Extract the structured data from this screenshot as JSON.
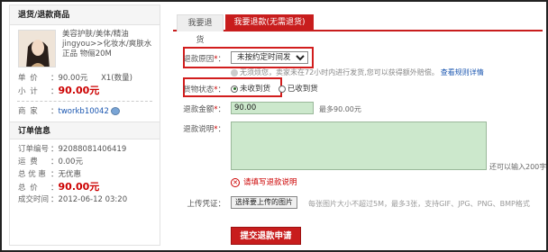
{
  "sidebar": {
    "title": "退货/退款商品",
    "product_name": "美容护肤/美体/精油 jingyou>>化妆水/爽肤水 正品 物俪20M",
    "price_label": "单 价",
    "price_value": "90.00元",
    "qty_value": "X1(数量)",
    "subtotal_label": "小 计",
    "subtotal_value": "90.00元",
    "seller_label": "商 家",
    "seller_name": "tworkb10042",
    "order_title": "订单信息",
    "order_no_label": "订单编号",
    "order_no_value": "92088081406419",
    "shipping_label": "运 费",
    "shipping_value": "0.00元",
    "discount_label": "总 优 惠",
    "discount_value": "无优惠",
    "total_label": "总 价",
    "total_value": "90.00元",
    "time_label": "成交时间",
    "time_value": "2012-06-12 03:20"
  },
  "tabs": [
    {
      "label": "我要退货"
    },
    {
      "label": "我要退款(无需退货)"
    }
  ],
  "form": {
    "reason_label": "退款原因",
    "reason_selected": "未按约定时间发货",
    "reason_notice": "无须烦您，卖家未在72小时内进行发货,您可以获得额外赔偿。",
    "rules_link": "查看规则详情",
    "goods_status_label": "货物状态",
    "opt_not_received": "未收到货",
    "opt_received": "已收到货",
    "amount_label": "退款金额",
    "amount_value": "90.00",
    "amount_max": "最多90.00元",
    "desc_label": "退款说明",
    "desc_remaining": "还可以输入200字",
    "error_text": "请填写退款说明",
    "upload_label": "上传凭证",
    "upload_button": "选择要上传的图片",
    "upload_hint": "每张图片大小不超过5M，最多3张，支持GIF、JPG、PNG、BMP格式",
    "submit": "提交退款申请"
  },
  "colors": {
    "accent": "#c81d1d",
    "field_bg": "#cce8cc",
    "link": "#1a56b0"
  }
}
